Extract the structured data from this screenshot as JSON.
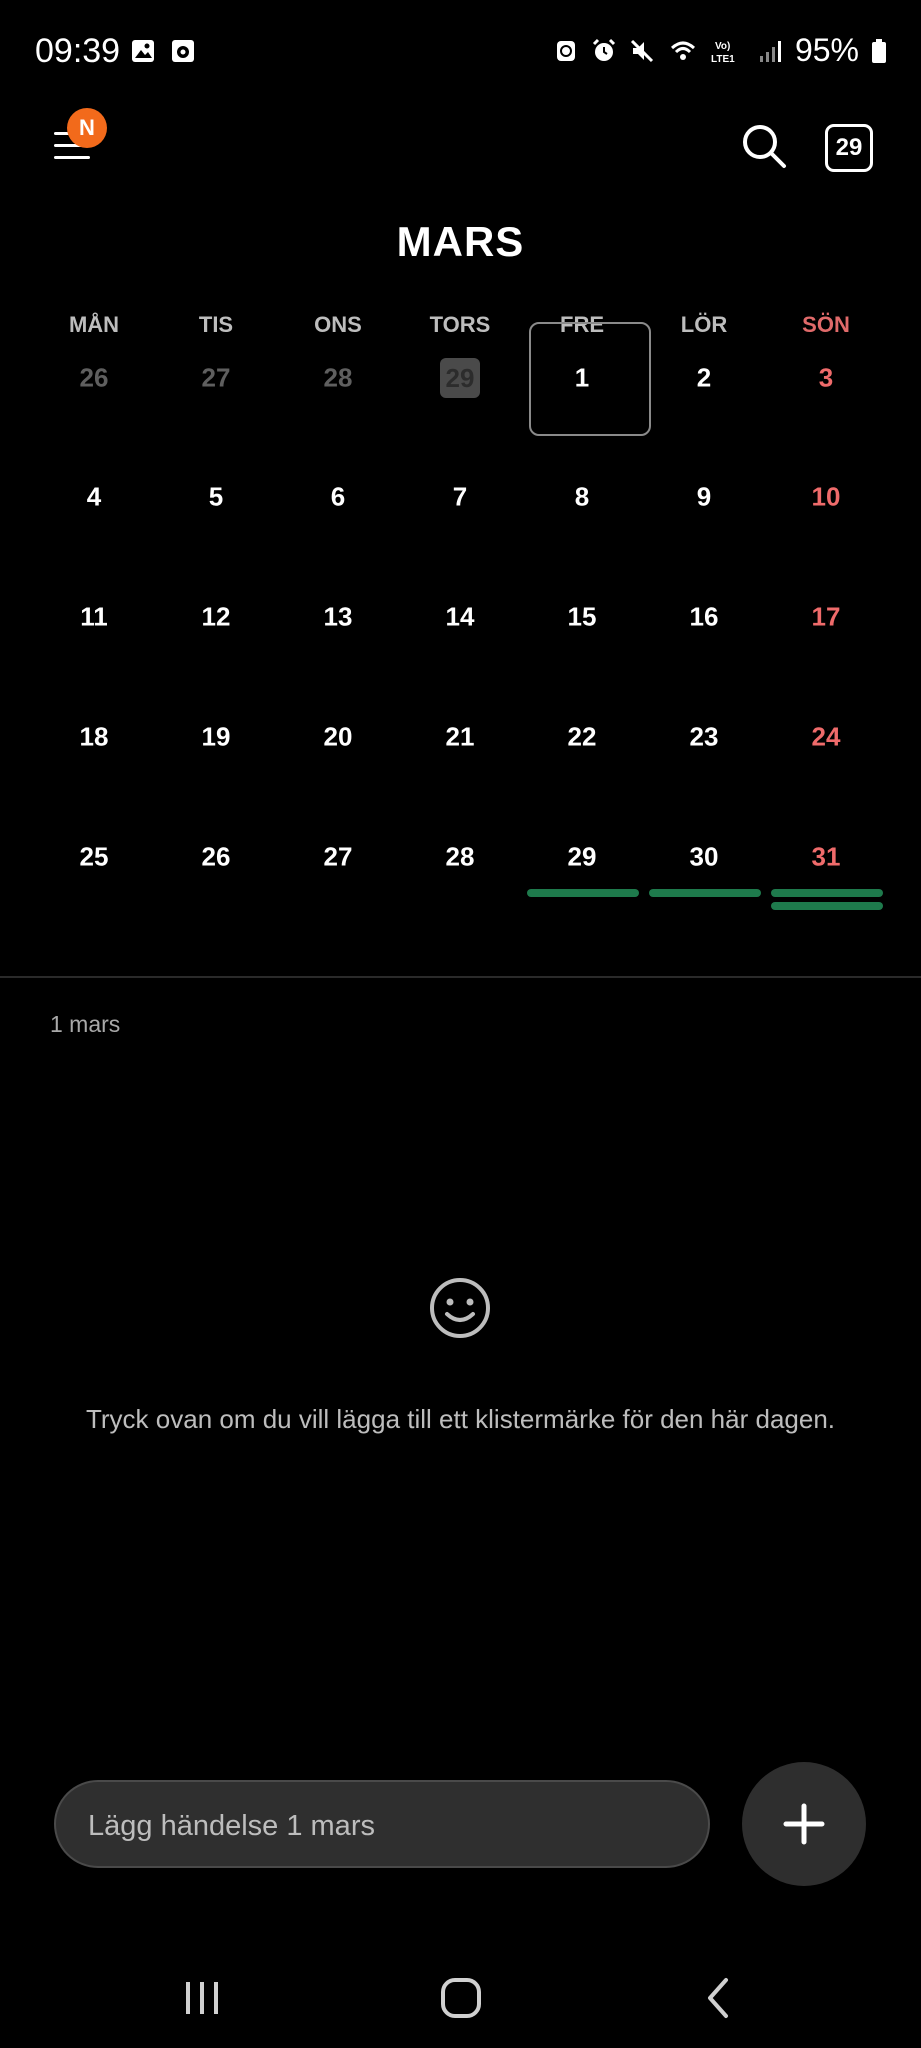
{
  "status_bar": {
    "time": "09:39",
    "battery": "95%",
    "icons_left": [
      "gallery-icon",
      "screen-recorder-icon"
    ],
    "icons_right": [
      "recycle-icon",
      "alarm-icon",
      "mute-icon",
      "wifi-icon",
      "volte-lte-icon",
      "signal-icon",
      "battery-icon"
    ]
  },
  "toolbar": {
    "menu_badge": "N",
    "today_button": "29"
  },
  "calendar": {
    "month_title": "MARS",
    "weekdays": [
      "MÅN",
      "TIS",
      "ONS",
      "TORS",
      "FRE",
      "LÖR",
      "SÖN"
    ],
    "weeks": [
      [
        "26",
        "27",
        "28",
        "29",
        "1",
        "2",
        "3"
      ],
      [
        "4",
        "5",
        "6",
        "7",
        "8",
        "9",
        "10"
      ],
      [
        "11",
        "12",
        "13",
        "14",
        "15",
        "16",
        "17"
      ],
      [
        "18",
        "19",
        "20",
        "21",
        "22",
        "23",
        "24"
      ],
      [
        "25",
        "26",
        "27",
        "28",
        "29",
        "30",
        "31"
      ]
    ],
    "event_color": "#1e7a4c",
    "sunday_color": "#ef6b6b"
  },
  "day_panel": {
    "selected_date": "1 mars",
    "sticker_hint": "Tryck ovan om du vill lägga till ett klistermärke för den här dagen."
  },
  "add_event": {
    "placeholder": "Lägg händelse 1 mars"
  }
}
